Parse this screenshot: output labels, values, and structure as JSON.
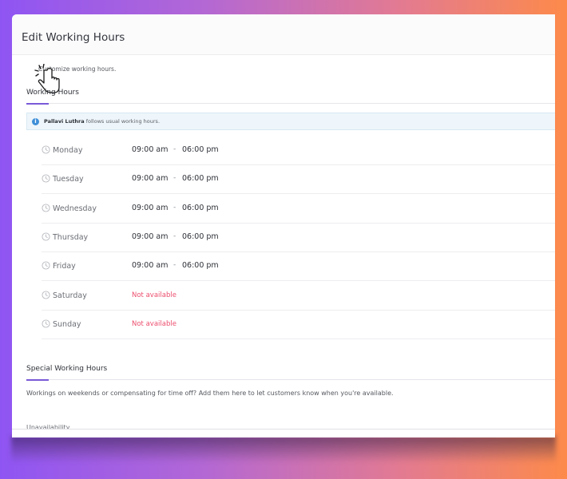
{
  "header": {
    "title": "Edit Working Hours"
  },
  "subtitle": "Customize working hours.",
  "working_hours": {
    "title": "Working Hours",
    "info": {
      "name": "Pallavi Luthra",
      "text": " follows usual working hours."
    },
    "days": [
      {
        "day": "Monday",
        "start": "09:00 am",
        "sep": "-",
        "end": "06:00 pm",
        "available": true
      },
      {
        "day": "Tuesday",
        "start": "09:00 am",
        "sep": "-",
        "end": "06:00 pm",
        "available": true
      },
      {
        "day": "Wednesday",
        "start": "09:00 am",
        "sep": "-",
        "end": "06:00 pm",
        "available": true
      },
      {
        "day": "Thursday",
        "start": "09:00 am",
        "sep": "-",
        "end": "06:00 pm",
        "available": true
      },
      {
        "day": "Friday",
        "start": "09:00 am",
        "sep": "-",
        "end": "06:00 pm",
        "available": true
      },
      {
        "day": "Saturday",
        "status": "Not available",
        "available": false
      },
      {
        "day": "Sunday",
        "status": "Not available",
        "available": false
      }
    ]
  },
  "special_working_hours": {
    "title": "Special Working Hours",
    "description": "Workings on weekends or compensating for time off? Add them here to let customers know when you're available."
  },
  "unavailability": {
    "title": "Unavailability"
  },
  "colors": {
    "accent": "#7a5ad8",
    "not_available": "#ec4d6d",
    "info_icon": "#3f8fd8"
  },
  "icons": {
    "row_icon": "clock-icon",
    "info_icon": "info-icon",
    "cursor": "hand-pointer-icon"
  }
}
